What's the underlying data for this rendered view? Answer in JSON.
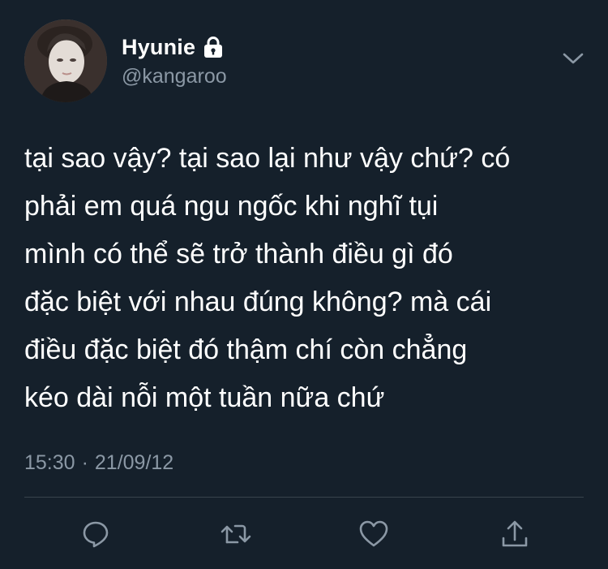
{
  "tweet": {
    "display_name": "Hyunie",
    "handle": "@kangaroo",
    "text": "tại sao vậy? tại sao lại như vậy chứ? có\nphải em quá ngu ngốc khi nghĩ tụi\nmình có thể sẽ trở thành điều gì đó\nđặc biệt với nhau đúng không? mà cái\nđiều đặc biệt đó thậm chí còn chẳng\nkéo dài nỗi một tuần nữa chứ",
    "time": "15:30",
    "separator": "·",
    "date": "21/09/12"
  },
  "icons": {
    "lock": "lock-icon",
    "menu": "chevron-down-icon",
    "reply": "reply-icon",
    "retweet": "retweet-icon",
    "like": "heart-icon",
    "share": "share-icon"
  },
  "colors": {
    "background": "#15202b",
    "text_primary": "#ffffff",
    "text_secondary": "#8b98a5",
    "divider": "#38444d",
    "icon": "#8b98a5"
  }
}
